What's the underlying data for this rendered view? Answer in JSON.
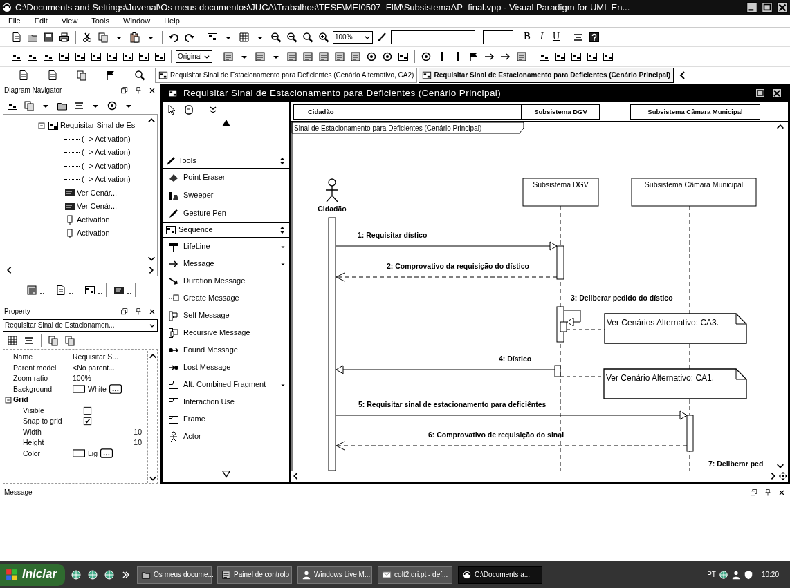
{
  "window": {
    "title": "C:\\Documents and Settings\\Juvenal\\Os meus documentos\\JUCA\\Trabalhos\\TESE\\MEI0507_FIM\\SubsistemaAP_final.vpp - Visual Paradigm for UML En..."
  },
  "menu": [
    "File",
    "Edit",
    "View",
    "Tools",
    "Window",
    "Help"
  ],
  "toolbar": {
    "zoom": "100%",
    "format_buttons": [
      "B",
      "I",
      "U"
    ],
    "view_mode": "Original"
  },
  "document_tabs": [
    {
      "label": "Requisitar Sinal de Estacionamento para Deficientes (Cenário Alternativo, CA2)",
      "selected": false
    },
    {
      "label": "Requisitar Sinal de Estacionamento para Deficientes (Cenário Principal)",
      "selected": true
    }
  ],
  "navigator": {
    "title": "Diagram Navigator",
    "tree": [
      {
        "label": "Requisitar Sinal de Es",
        "kind": "diagram",
        "expanded": true,
        "children": [
          {
            "label": "( -> Activation)",
            "kind": "link"
          },
          {
            "label": "( -> Activation)",
            "kind": "link"
          },
          {
            "label": "( -> Activation)",
            "kind": "link"
          },
          {
            "label": "( -> Activation)",
            "kind": "link"
          },
          {
            "label": "Ver Cenár...",
            "kind": "note"
          },
          {
            "label": "Ver Cenár...",
            "kind": "note"
          },
          {
            "label": "Activation",
            "kind": "activation"
          },
          {
            "label": "Activation",
            "kind": "activation"
          }
        ]
      }
    ]
  },
  "property": {
    "title": "Property",
    "selected_element": "Requisitar Sinal de Estacionamen...",
    "rows": [
      {
        "label": "Name",
        "value": "Requisitar S...",
        "kind": "text"
      },
      {
        "label": "Parent model",
        "value": "<No parent...",
        "kind": "text"
      },
      {
        "label": "Zoom ratio",
        "value": "100%",
        "kind": "text"
      },
      {
        "label": "Background",
        "value": "White",
        "kind": "color"
      },
      {
        "label": "Grid",
        "kind": "group",
        "expanded": true,
        "children": [
          {
            "label": "Visible",
            "kind": "check",
            "checked": false
          },
          {
            "label": "Snap to grid",
            "kind": "check",
            "checked": true
          },
          {
            "label": "Width",
            "value": "10",
            "kind": "number"
          },
          {
            "label": "Height",
            "value": "10",
            "kind": "number"
          },
          {
            "label": "Color",
            "value": "Lig",
            "kind": "color"
          }
        ]
      }
    ]
  },
  "diagram_window": {
    "title": "Requisitar Sinal de Estacionamento para Deficientes (Cenário Principal)",
    "palette": [
      {
        "label": "Tools",
        "expanded": true,
        "items": [
          {
            "label": "Point Eraser",
            "has_menu": false
          },
          {
            "label": "Sweeper",
            "has_menu": false
          },
          {
            "label": "Gesture Pen",
            "has_menu": false
          }
        ]
      },
      {
        "label": "Sequence",
        "expanded": true,
        "items": [
          {
            "label": "LifeLine",
            "has_menu": true
          },
          {
            "label": "Message",
            "has_menu": true
          },
          {
            "label": "Duration Message",
            "has_menu": false
          },
          {
            "label": "Create Message",
            "has_menu": false
          },
          {
            "label": "Self Message",
            "has_menu": false
          },
          {
            "label": "Recursive Message",
            "has_menu": false
          },
          {
            "label": "Found Message",
            "has_menu": false
          },
          {
            "label": "Lost Message",
            "has_menu": false
          },
          {
            "label": "Alt. Combined Fragment",
            "has_menu": true
          },
          {
            "label": "Interaction Use",
            "has_menu": false
          },
          {
            "label": "Frame",
            "has_menu": false
          },
          {
            "label": "Actor",
            "has_menu": false
          }
        ]
      }
    ],
    "lanes": [
      "Cidadão",
      "Subsistema DGV",
      "Subsistema Câmara Municipal"
    ],
    "frame_label": "Sinal de Estacionamento para Deficientes (Cenário Principal)",
    "lifelines": [
      {
        "name": "Cidadão",
        "kind": "actor"
      },
      {
        "name": "Subsistema DGV",
        "kind": "object"
      },
      {
        "name": "Subsistema Câmara Municipal",
        "kind": "object"
      }
    ],
    "messages": [
      {
        "label": "1: Requisitar dístico",
        "kind": "call"
      },
      {
        "label": "2: Comprovativo da requisição do dístico",
        "kind": "return"
      },
      {
        "label": "3: Deliberar pedido do dístico",
        "kind": "self"
      },
      {
        "label": "4: Dístico",
        "kind": "call"
      },
      {
        "label": "5: Requisitar sinal de estacionamento para deficiêntes",
        "kind": "call"
      },
      {
        "label": "6: Comprovativo de requisição do sinal",
        "kind": "return"
      },
      {
        "label": "7: Deliberar ped",
        "kind": "partial"
      }
    ],
    "notes": [
      {
        "text": "Ver Cenários Alternativo: CA3."
      },
      {
        "text": "Ver Cenário Alternativo: CA1."
      }
    ]
  },
  "message_panel": {
    "title": "Message"
  },
  "taskbar": {
    "start": "Iniciar",
    "tasks": [
      {
        "label": "Os meus docume...",
        "selected": false
      },
      {
        "label": "Painel de controlo",
        "selected": false
      },
      {
        "label": "Windows Live M...",
        "selected": false
      },
      {
        "label": "colt2.dri.pt - def...",
        "selected": false
      },
      {
        "label": "C:\\Documents a...",
        "selected": true
      }
    ],
    "language": "PT",
    "clock": "10:20"
  }
}
